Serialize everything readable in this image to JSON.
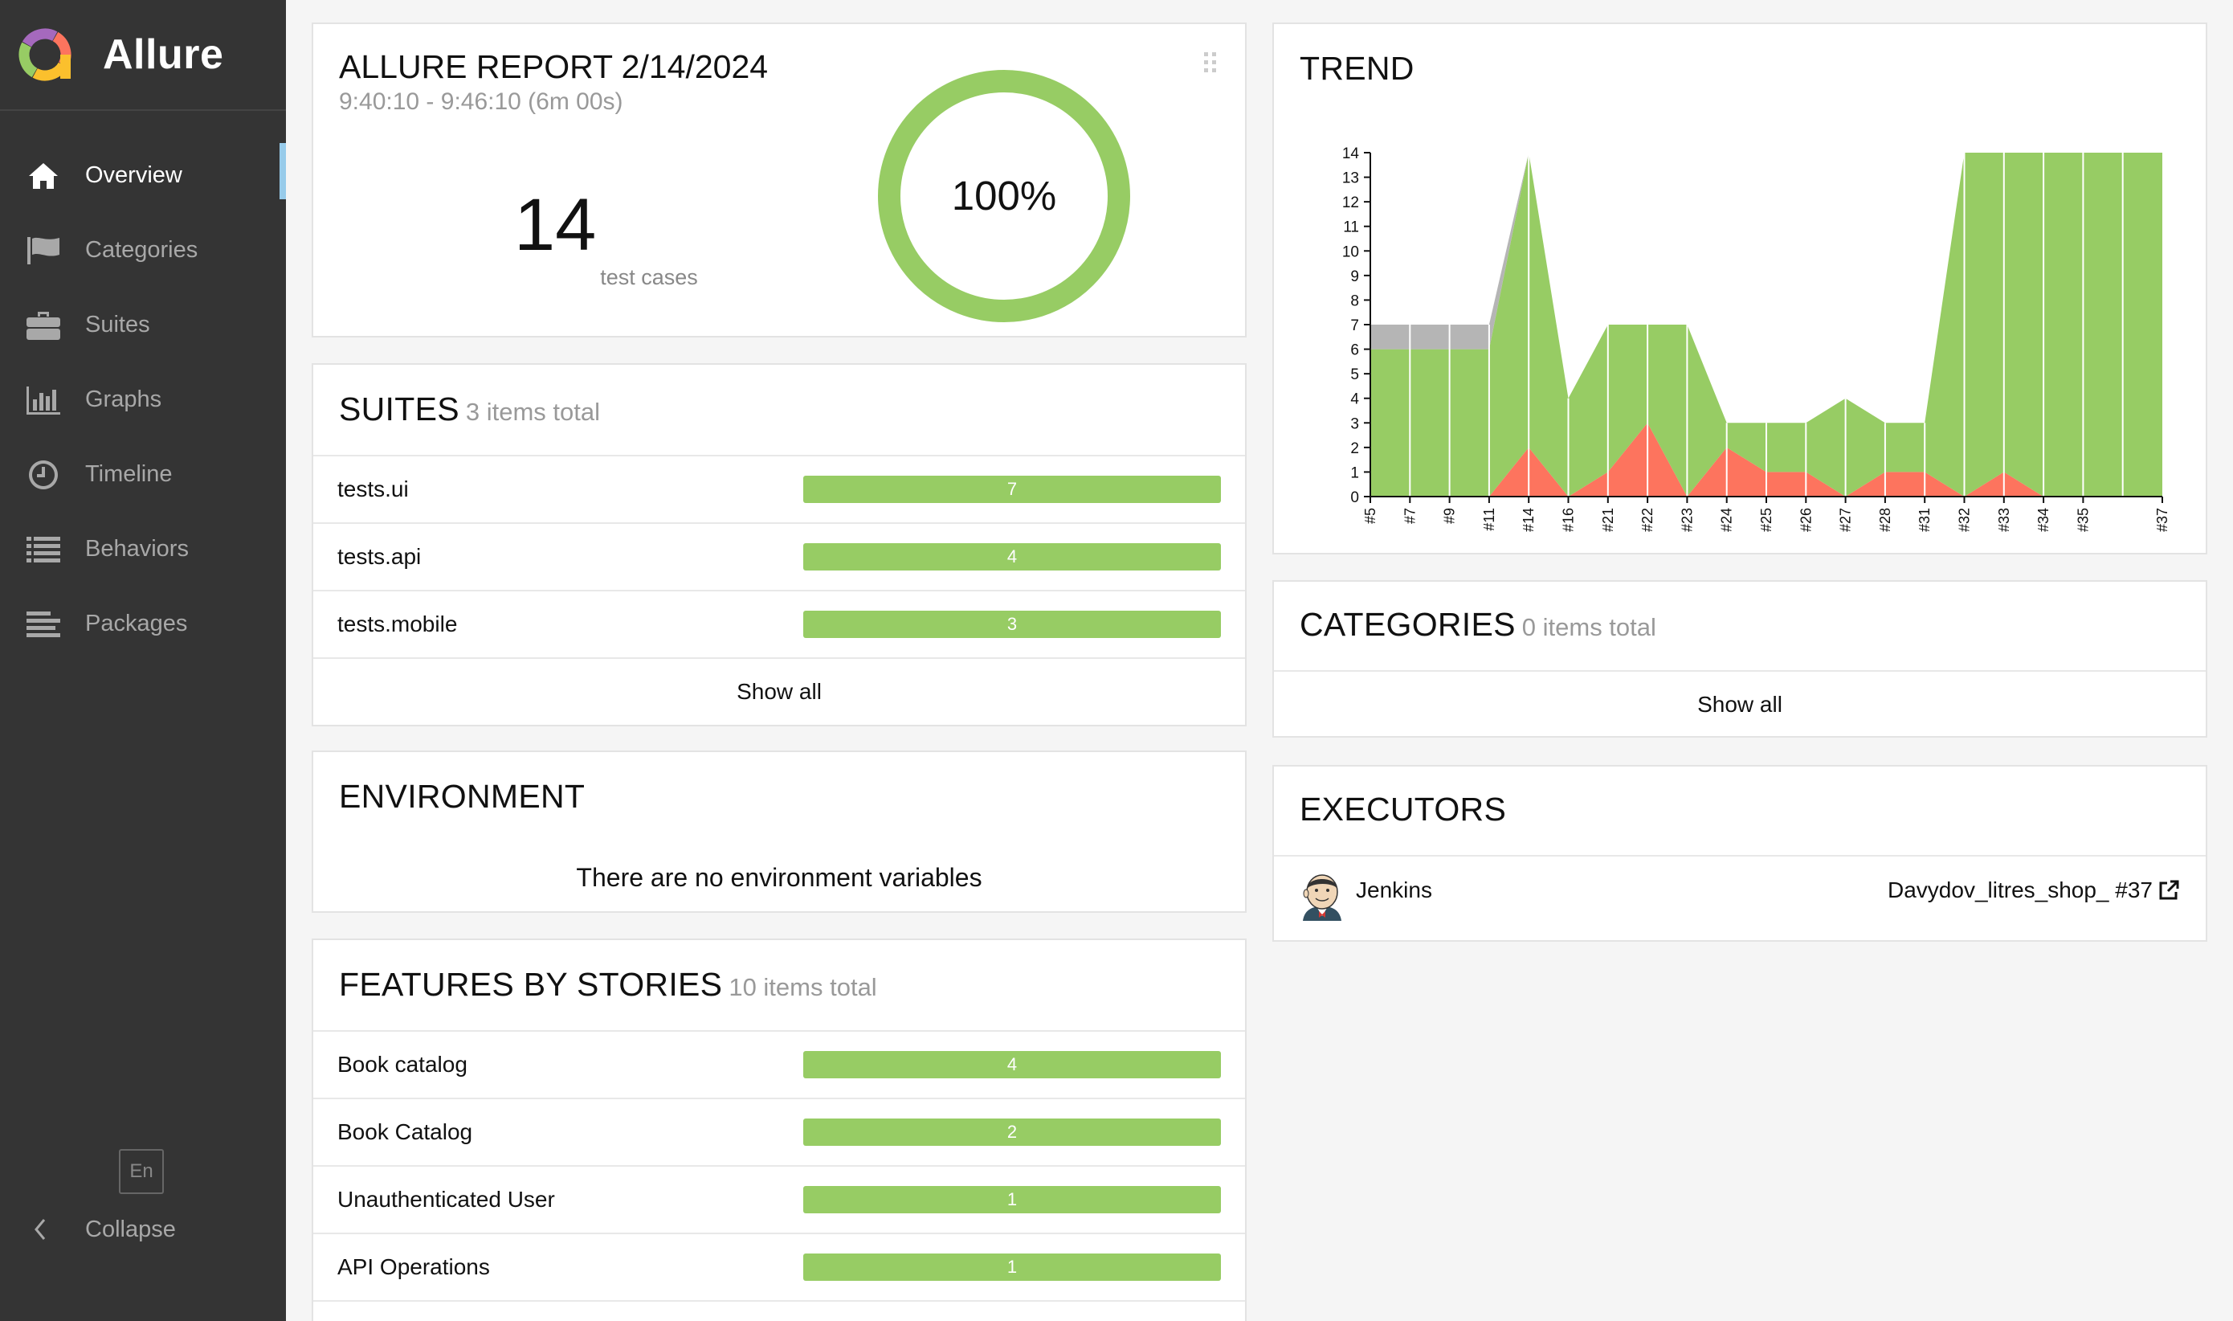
{
  "app": {
    "name": "Allure"
  },
  "sidebar": {
    "items": [
      {
        "label": "Overview",
        "icon": "home-icon",
        "active": true
      },
      {
        "label": "Categories",
        "icon": "flag-icon",
        "active": false
      },
      {
        "label": "Suites",
        "icon": "briefcase-icon",
        "active": false
      },
      {
        "label": "Graphs",
        "icon": "bar-chart-icon",
        "active": false
      },
      {
        "label": "Timeline",
        "icon": "clock-icon",
        "active": false
      },
      {
        "label": "Behaviors",
        "icon": "list-icon",
        "active": false
      },
      {
        "label": "Packages",
        "icon": "align-left-icon",
        "active": false
      }
    ],
    "language": "En",
    "collapse_label": "Collapse"
  },
  "summary": {
    "title": "ALLURE REPORT 2/14/2024",
    "time": "9:40:10 - 9:46:10 (6m 00s)",
    "test_count": "14",
    "test_count_label": "test cases",
    "success_rate": "100%",
    "success_fraction": 1.0
  },
  "suites": {
    "title": "SUITES",
    "subtitle": "3 items total",
    "items": [
      {
        "name": "tests.ui",
        "count": "7"
      },
      {
        "name": "tests.api",
        "count": "4"
      },
      {
        "name": "tests.mobile",
        "count": "3"
      }
    ],
    "show_all": "Show all"
  },
  "environment": {
    "title": "ENVIRONMENT",
    "empty_text": "There are no environment variables"
  },
  "features": {
    "title": "FEATURES BY STORIES",
    "subtitle": "10 items total",
    "items": [
      {
        "name": "Book catalog",
        "count": "4"
      },
      {
        "name": "Book Catalog",
        "count": "2"
      },
      {
        "name": "Unauthenticated User",
        "count": "1"
      },
      {
        "name": "API Operations",
        "count": "1"
      }
    ]
  },
  "trend": {
    "title": "TREND"
  },
  "categories": {
    "title": "CATEGORIES",
    "subtitle": "0 items total",
    "show_all": "Show all"
  },
  "executors": {
    "title": "EXECUTORS",
    "name": "Jenkins",
    "build": "Davydov_litres_shop_ #37"
  },
  "colors": {
    "passed": "#97cc64",
    "failed": "#fd745e",
    "unknown": "#b5b5b5",
    "sidebar": "#343434",
    "accent": "#97cbea"
  },
  "chart_data": {
    "type": "area",
    "title": "",
    "xlabel": "",
    "ylabel": "",
    "ylim": [
      0,
      14
    ],
    "x": [
      "#5",
      "#7",
      "#9",
      "#11",
      "#14",
      "#16",
      "#21",
      "#22",
      "#23",
      "#24",
      "#25",
      "#26",
      "#27",
      "#28",
      "#31",
      "#32",
      "#33",
      "#34",
      "#35",
      "#37"
    ],
    "yticks": [
      0,
      1,
      2,
      3,
      4,
      5,
      6,
      7,
      8,
      9,
      10,
      11,
      12,
      13,
      14
    ],
    "series": [
      {
        "status": "failed",
        "values": [
          0,
          0,
          0,
          0,
          2,
          0,
          1,
          3,
          0,
          2,
          1,
          1,
          0,
          1,
          1,
          0,
          1,
          0,
          0,
          0
        ]
      },
      {
        "status": "passed",
        "values": [
          6,
          6,
          6,
          6,
          12,
          4,
          6,
          4,
          7,
          1,
          2,
          2,
          4,
          2,
          2,
          14,
          13,
          14,
          14,
          14
        ]
      },
      {
        "status": "unknown",
        "values": [
          1,
          1,
          1,
          1,
          0,
          0,
          0,
          0,
          0,
          0,
          0,
          0,
          0,
          0,
          0,
          0,
          0,
          0,
          0,
          0
        ]
      }
    ],
    "grid": false,
    "legend": "none"
  }
}
